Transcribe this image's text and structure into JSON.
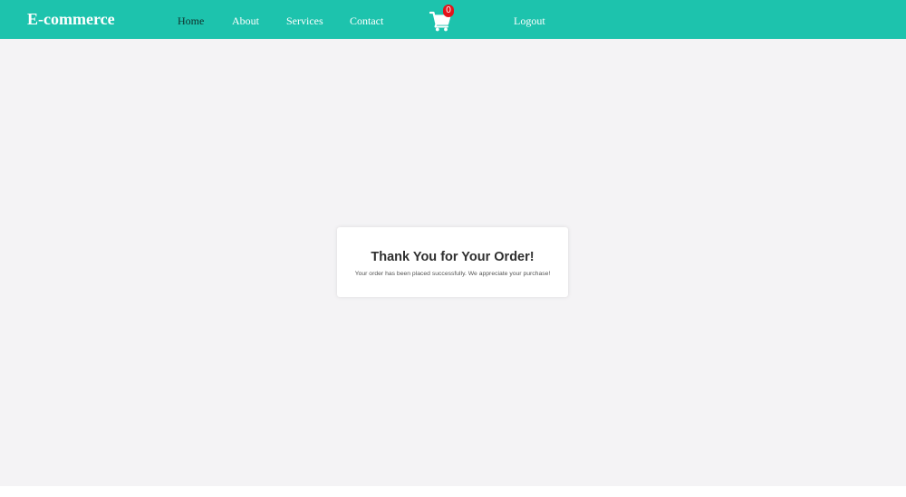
{
  "navbar": {
    "brand": "E-commerce",
    "links": [
      {
        "label": "Home"
      },
      {
        "label": "About"
      },
      {
        "label": "Services"
      },
      {
        "label": "Contact"
      }
    ],
    "cart": {
      "count": "0",
      "icon": "cart-icon"
    },
    "logout_label": "Logout",
    "colors": {
      "background": "#1dc3ad",
      "badge": "#e3141b"
    }
  },
  "confirmation": {
    "title": "Thank You for Your Order!",
    "message": "Your order has been placed successfully. We appreciate your purchase!"
  }
}
